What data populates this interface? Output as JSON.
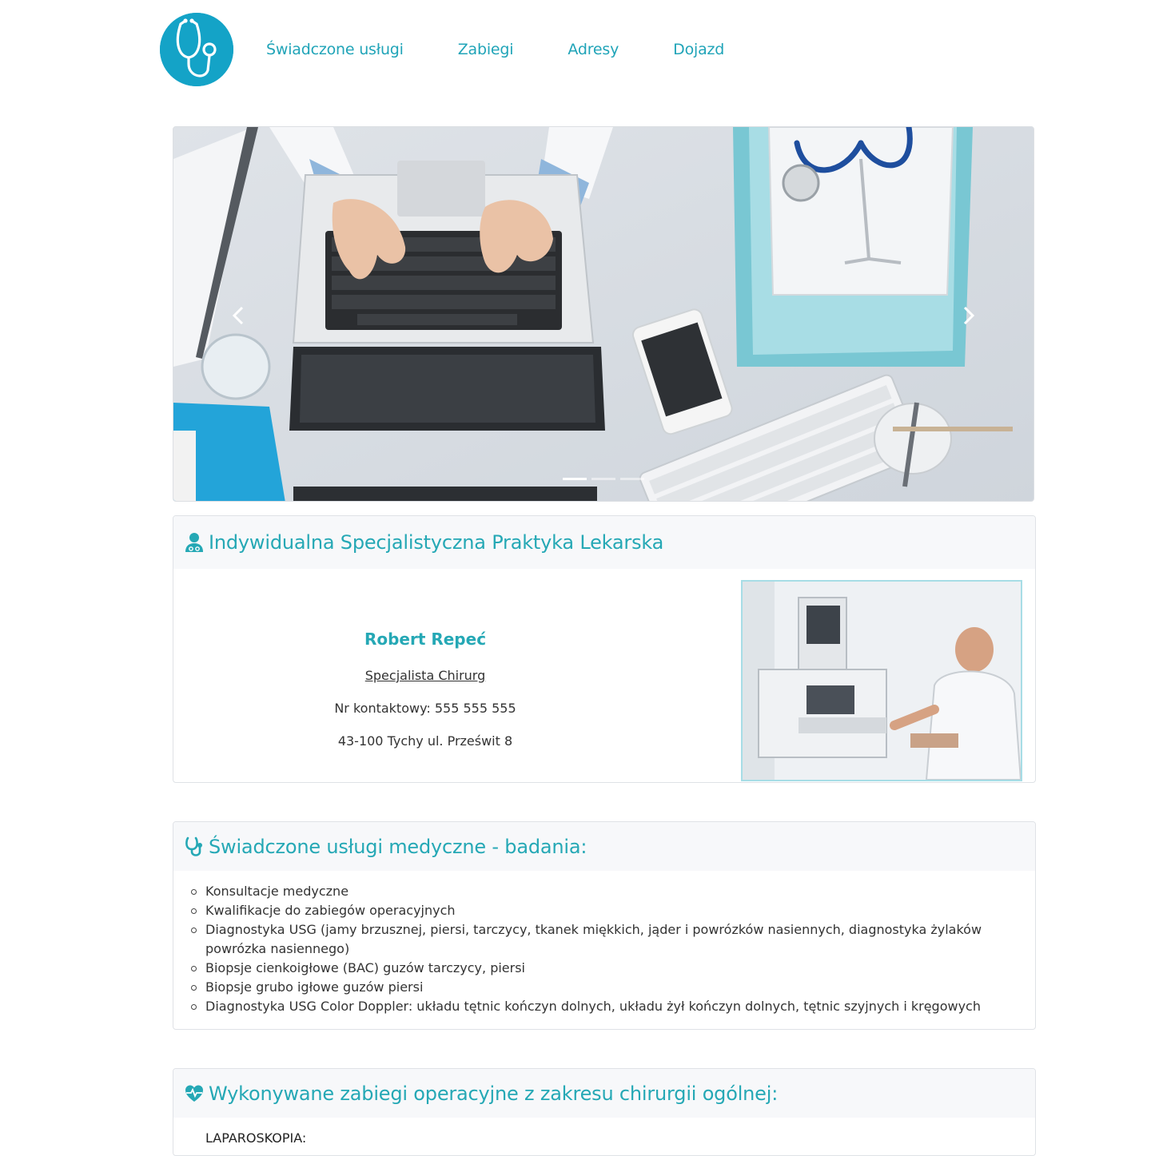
{
  "nav": {
    "items": [
      "Świadczone usługi",
      "Zabiegi",
      "Adresy",
      "Dojazd"
    ]
  },
  "carousel": {
    "slide_count": 3,
    "active_index": 0
  },
  "practice": {
    "title": "Indywidualna Specjalistyczna Praktyka Lekarska",
    "doctor_name": "Robert Repeć",
    "specialty": "Specjalista Chirurg",
    "phone": "Nr kontaktowy: 555 555 555",
    "address": "43-100 Tychy ul. Prześwit 8"
  },
  "services": {
    "title": "Świadczone usługi medyczne - badania:",
    "items": [
      "Konsultacje medyczne",
      "Kwalifikacje do zabiegów operacyjnych",
      "Diagnostyka USG (jamy brzusznej, piersi, tarczycy, tkanek miękkich, jąder i powrózków nasiennych, diagnostyka żylaków powrózka nasiennego)",
      "Biopsje cienkoigłowe (BAC) guzów tarczycy, piersi",
      "Biopsje grubo igłowe guzów piersi",
      "Diagnostyka USG Color Doppler: układu tętnic kończyn dolnych, układu żył kończyn dolnych, tętnic szyjnych i kręgowych"
    ]
  },
  "procedures": {
    "title": "Wykonywane zabiegi operacyjne z zakresu chirurgii ogólnej:",
    "first_section": "LAPAROSKOPIA:"
  },
  "colors": {
    "accent": "#25a8b5",
    "logo": "#14a3c7",
    "card_header_bg": "#f7f8fa"
  },
  "icons": {
    "logo": "stethoscope-icon",
    "practice": "user-doctor-icon",
    "services": "stethoscope-icon",
    "procedures": "heartbeat-icon",
    "carousel_prev": "chevron-left-icon",
    "carousel_next": "chevron-right-icon"
  }
}
